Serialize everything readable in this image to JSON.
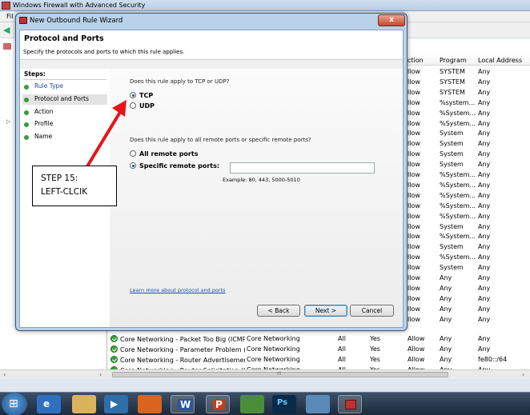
{
  "app": {
    "title": "Windows Firewall with Advanced Security",
    "menu_fragment": "Fil"
  },
  "table": {
    "columns": [
      "ction",
      "Program",
      "Local Address"
    ],
    "rows": [
      {
        "action": "llow",
        "program": "SYSTEM",
        "local": "Any"
      },
      {
        "action": "llow",
        "program": "SYSTEM",
        "local": "Any"
      },
      {
        "action": "llow",
        "program": "SYSTEM",
        "local": "Any"
      },
      {
        "action": "llow",
        "program": "%system...",
        "local": "Any"
      },
      {
        "action": "llow",
        "program": "%System...",
        "local": "Any"
      },
      {
        "action": "llow",
        "program": "%System...",
        "local": "Any"
      },
      {
        "action": "llow",
        "program": "System",
        "local": "Any"
      },
      {
        "action": "llow",
        "program": "System",
        "local": "Any"
      },
      {
        "action": "llow",
        "program": "System",
        "local": "Any"
      },
      {
        "action": "llow",
        "program": "System",
        "local": "Any"
      },
      {
        "action": "llow",
        "program": "%System...",
        "local": "Any"
      },
      {
        "action": "llow",
        "program": "%System...",
        "local": "Any"
      },
      {
        "action": "llow",
        "program": "%System...",
        "local": "Any"
      },
      {
        "action": "llow",
        "program": "%System...",
        "local": "Any"
      },
      {
        "action": "llow",
        "program": "%System...",
        "local": "Any"
      },
      {
        "action": "llow",
        "program": "System",
        "local": "Any"
      },
      {
        "action": "llow",
        "program": "%System...",
        "local": "Any"
      },
      {
        "action": "llow",
        "program": "System",
        "local": "Any"
      },
      {
        "action": "llow",
        "program": "%System...",
        "local": "Any"
      },
      {
        "action": "llow",
        "program": "System",
        "local": "Any"
      },
      {
        "action": "llow",
        "program": "Any",
        "local": "Any"
      },
      {
        "action": "llow",
        "program": "Any",
        "local": "Any"
      },
      {
        "action": "llow",
        "program": "Any",
        "local": "Any"
      },
      {
        "action": "llow",
        "program": "Any",
        "local": "Any"
      },
      {
        "action": "llow",
        "program": "Any",
        "local": "Any"
      }
    ],
    "full_rows": [
      {
        "name": "Core Networking - Packet Too Big (ICMP...",
        "group": "Core Networking",
        "profile": "All",
        "enabled": "Yes",
        "action": "Allow",
        "program": "Any",
        "local": "Any"
      },
      {
        "name": "Core Networking - Parameter Problem (I...",
        "group": "Core Networking",
        "profile": "All",
        "enabled": "Yes",
        "action": "Allow",
        "program": "Any",
        "local": "Any"
      },
      {
        "name": "Core Networking - Router Advertisement...",
        "group": "Core Networking",
        "profile": "All",
        "enabled": "Yes",
        "action": "Allow",
        "program": "Any",
        "local": "fe80::/64"
      },
      {
        "name": "Core Networking - Router Solicitation (IC...",
        "group": "Core Networking",
        "profile": "All",
        "enabled": "Yes",
        "action": "Allow",
        "program": "Any",
        "local": "Any"
      }
    ]
  },
  "dialog": {
    "title": "New Outbound Rule Wizard",
    "close_label": "x",
    "heading": "Protocol and Ports",
    "subheading": "Specify the protocols and ports to which this rule applies.",
    "steps_title": "Steps:",
    "steps": [
      "Rule Type",
      "Protocol and Ports",
      "Action",
      "Profile",
      "Name"
    ],
    "q1": "Does this rule apply to TCP or UDP?",
    "tcp": "TCP",
    "udp": "UDP",
    "q2": "Does this rule apply to all remote ports or specific remote ports?",
    "all_ports": "All remote ports",
    "specific_ports": "Specific remote ports:",
    "ports_value": "",
    "example": "Example: 80, 443, 5000-5010",
    "learn_more": "Learn more about protocol and ports",
    "back": "< Back",
    "next": "Next >",
    "cancel": "Cancel"
  },
  "annotation": {
    "line1": "STEP 15:",
    "line2": "LEFT-CLCIK",
    "color": "#e8141a"
  },
  "scrollbar": {
    "left_arrow": "‹",
    "right_arrow": "›",
    "thumb_grip": "III"
  }
}
